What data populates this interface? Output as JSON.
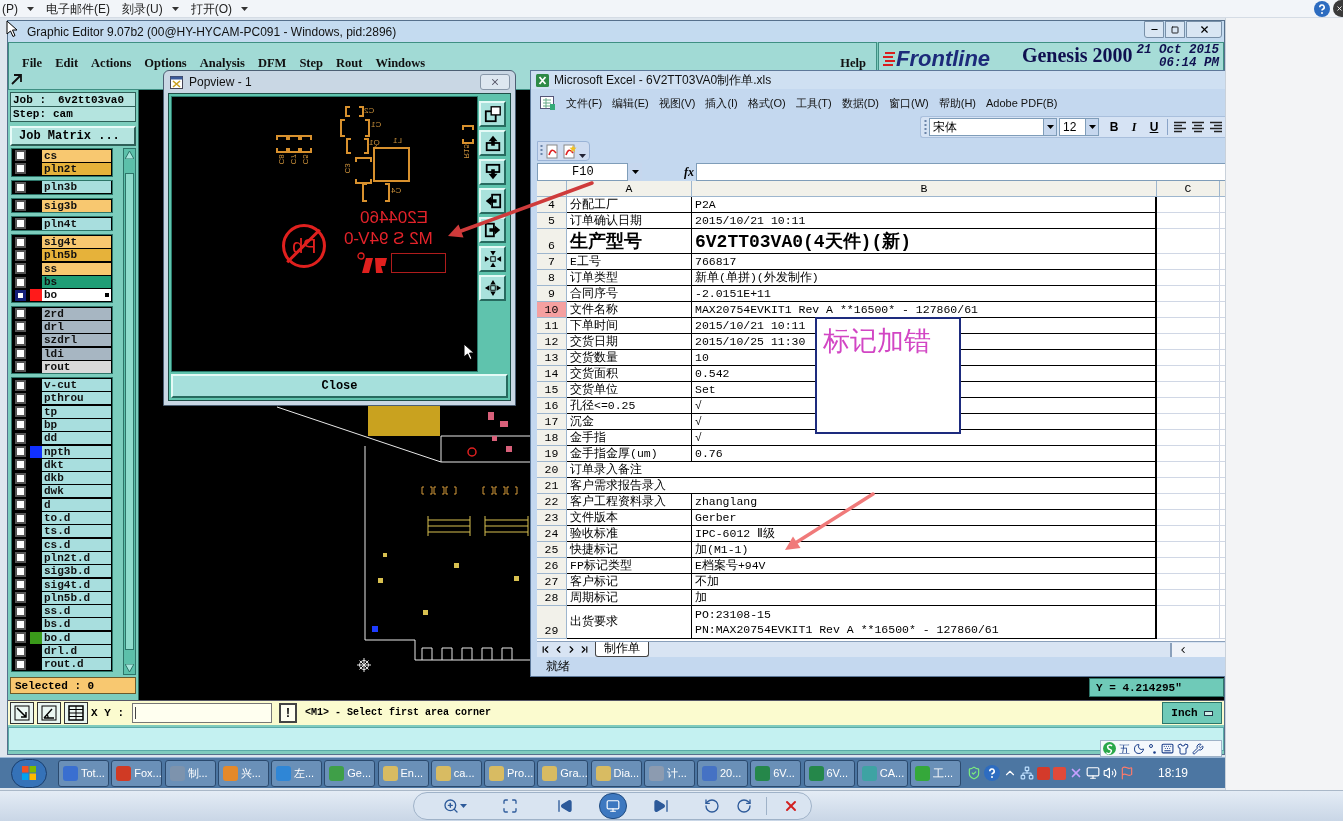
{
  "viewer_menu": [
    {
      "label": "(P)",
      "dropdown": true
    },
    {
      "label": "电子邮件(E)",
      "dropdown": false
    },
    {
      "label": "刻录(U)",
      "dropdown": true
    },
    {
      "label": "打开(O)",
      "dropdown": true
    }
  ],
  "genesis": {
    "title": "Graphic Editor 9.07b2 (00@HY-HYCAM-PC091 - Windows, pid:2896)",
    "menu": [
      "File",
      "Edit",
      "Actions",
      "Options",
      "Analysis",
      "DFM",
      "Step",
      "Rout",
      "Windows"
    ],
    "help_menu": "Help",
    "brand": {
      "logo": "Frontline",
      "product": "Genesis 2000",
      "date": "21 Oct 2015",
      "time": "06:14 PM"
    },
    "job": {
      "label": "Job :",
      "value": "6v2tt03va0"
    },
    "step": {
      "label": "Step:",
      "value": "cam"
    },
    "job_matrix_button": "Job Matrix ...",
    "layer_groups": [
      {
        "layers": [
          {
            "name": "cs",
            "color": "#f8c870",
            "selected": false
          },
          {
            "name": "pln2t",
            "color": "#e6b23a",
            "selected": false
          }
        ]
      },
      {
        "layers": [
          {
            "name": "pln3b",
            "color": "#a8dede",
            "selected": false
          }
        ]
      },
      {
        "layers": [
          {
            "name": "sig3b",
            "color": "#f8c870",
            "selected": false
          }
        ]
      },
      {
        "layers": [
          {
            "name": "pln4t",
            "color": "#a8dede",
            "selected": false
          }
        ]
      },
      {
        "layers": [
          {
            "name": "sig4t",
            "color": "#f8c870",
            "selected": false
          },
          {
            "name": "pln5b",
            "color": "#e6b23a",
            "selected": false
          },
          {
            "name": "ss",
            "color": "#f8c870",
            "selected": false
          },
          {
            "name": "bs",
            "color": "#1f9e76",
            "selected": false
          },
          {
            "name": "bo",
            "color": "#ffffff",
            "selected": true,
            "swatch": {
              "color": "#ff1a1a"
            }
          }
        ]
      },
      {
        "layers": [
          {
            "name": "2rd",
            "color": "#a7b6c2",
            "selected": false
          },
          {
            "name": "drl",
            "color": "#a7b6c2",
            "selected": false
          },
          {
            "name": "szdrl",
            "color": "#a7b6c2",
            "selected": false
          },
          {
            "name": "ldi",
            "color": "#a7b6c2",
            "selected": false
          },
          {
            "name": "rout",
            "color": "#dadada",
            "selected": false
          }
        ]
      },
      {
        "layers": [
          {
            "name": "v-cut",
            "color": "#a8dede",
            "selected": false
          },
          {
            "name": "pthrou",
            "color": "#a8dede",
            "selected": false
          },
          {
            "name": "tp",
            "color": "#a8dede",
            "selected": false
          },
          {
            "name": "bp",
            "color": "#a8dede",
            "selected": false
          },
          {
            "name": "dd",
            "color": "#a8dede",
            "selected": false
          },
          {
            "name": "npth",
            "color": "#a8dede",
            "selected": false,
            "swatch": {
              "color": "#1030ff"
            }
          },
          {
            "name": "dkt",
            "color": "#a8dede",
            "selected": false
          },
          {
            "name": "dkb",
            "color": "#a8dede",
            "selected": false
          },
          {
            "name": "dwk",
            "color": "#a8dede",
            "selected": false
          },
          {
            "name": "d",
            "color": "#a8dede",
            "selected": false
          },
          {
            "name": "to.d",
            "color": "#a8dede",
            "selected": false
          },
          {
            "name": "ts.d",
            "color": "#a8dede",
            "selected": false
          },
          {
            "name": "cs.d",
            "color": "#a8dede",
            "selected": false
          },
          {
            "name": "pln2t.d",
            "color": "#a8dede",
            "selected": false
          },
          {
            "name": "sig3b.d",
            "color": "#a8dede",
            "selected": false
          },
          {
            "name": "sig4t.d",
            "color": "#a8dede",
            "selected": false
          },
          {
            "name": "pln5b.d",
            "color": "#a8dede",
            "selected": false
          },
          {
            "name": "ss.d",
            "color": "#a8dede",
            "selected": false
          },
          {
            "name": "bs.d",
            "color": "#a8dede",
            "selected": false
          },
          {
            "name": "bo.d",
            "color": "#a8dede",
            "selected": false,
            "swatch": {
              "color": "#3a9a1a"
            }
          },
          {
            "name": "drl.d",
            "color": "#a8dede",
            "selected": false
          },
          {
            "name": "rout.d",
            "color": "#a8dede",
            "selected": false
          }
        ]
      }
    ],
    "selected_count": "Selected : 0",
    "coordinate": "Y = 4.214295\"",
    "xy_label": "X Y :",
    "alert_button": "!",
    "prompt": "<M1> - Select first area corner",
    "units_button": "Inch"
  },
  "popview": {
    "title": "Popview - 1",
    "silkscreen": [
      "C2",
      "C1",
      "Q1",
      "L1",
      "C3",
      "C4",
      "C8",
      "C7",
      "C5",
      "R15"
    ],
    "marking_lines": [
      "E204460",
      "M2 S 94V-0"
    ],
    "pb_mark": "Pb",
    "close_button": "Close"
  },
  "excel": {
    "title": "Microsoft Excel - 6V2TT03VA0制作单.xls",
    "menu": [
      "文件(F)",
      "编辑(E)",
      "视图(V)",
      "插入(I)",
      "格式(O)",
      "工具(T)",
      "数据(D)",
      "窗口(W)",
      "帮助(H)",
      "Adobe PDF(B)"
    ],
    "font": "宋体",
    "font_size": "12",
    "format_buttons": [
      "B",
      "I",
      "U"
    ],
    "name_box": "F10",
    "function_button": "fx",
    "columns": [
      "A",
      "B",
      "C"
    ],
    "rows": [
      {
        "num": "4",
        "label": "分配工厂",
        "value": "P2A",
        "kind": "normal",
        "selected": false
      },
      {
        "num": "5",
        "label": "订单确认日期",
        "value": "2015/10/21 10:11",
        "kind": "normal",
        "selected": false
      },
      {
        "num": "6",
        "label": "生产型号",
        "value": "6V2TT03VA0(4天件)(新)",
        "kind": "large",
        "selected": false
      },
      {
        "num": "7",
        "label": "E工号",
        "value": "766817",
        "kind": "normal",
        "selected": false
      },
      {
        "num": "8",
        "label": "订单类型",
        "value": "新单(单拼)(外发制作)",
        "kind": "normal",
        "selected": false
      },
      {
        "num": "9",
        "label": "合同序号",
        "value": "-2.0151E+11",
        "kind": "normal",
        "selected": false
      },
      {
        "num": "10",
        "label": "文件名称",
        "value": "MAX20754EVKIT1 Rev A **16500* - 127860/61",
        "kind": "normal",
        "selected": true
      },
      {
        "num": "11",
        "label": "下单时间",
        "value": "2015/10/21 10:11",
        "kind": "normal",
        "selected": false
      },
      {
        "num": "12",
        "label": "交货日期",
        "value": "2015/10/25 11:30",
        "kind": "normal",
        "selected": false
      },
      {
        "num": "13",
        "label": "交货数量",
        "value": "10",
        "kind": "normal",
        "selected": false
      },
      {
        "num": "14",
        "label": "交货面积",
        "value": "0.542",
        "kind": "normal",
        "selected": false
      },
      {
        "num": "15",
        "label": "交货单位",
        "value": "Set",
        "kind": "normal",
        "selected": false
      },
      {
        "num": "16",
        "label": "孔径<=0.25",
        "value": "√",
        "kind": "normal",
        "selected": false
      },
      {
        "num": "17",
        "label": "沉金",
        "value": "√",
        "kind": "normal",
        "selected": false
      },
      {
        "num": "18",
        "label": "金手指",
        "value": "√",
        "kind": "normal",
        "selected": false
      },
      {
        "num": "19",
        "label": "金手指金厚(um)",
        "value": "0.76",
        "kind": "normal",
        "selected": false
      },
      {
        "num": "20",
        "label": "订单录入备注",
        "kind": "merged",
        "selected": false
      },
      {
        "num": "21",
        "label": "客户需求报告录入",
        "kind": "merged",
        "selected": false
      },
      {
        "num": "22",
        "label": "客户工程资料录入",
        "value": "zhanglang",
        "kind": "normal",
        "selected": false
      },
      {
        "num": "23",
        "label": "文件版本",
        "value": "Gerber",
        "kind": "normal",
        "selected": false
      },
      {
        "num": "24",
        "label": "验收标准",
        "value": "IPC-6012 Ⅱ级",
        "kind": "normal",
        "selected": false
      },
      {
        "num": "25",
        "label": "快捷标记",
        "value": "加(M1-1)",
        "kind": "normal",
        "selected": false
      },
      {
        "num": "26",
        "label": "FP标记类型",
        "value": "E档案号+94V",
        "kind": "normal",
        "selected": false
      },
      {
        "num": "27",
        "label": "客户标记",
        "value": "不加",
        "kind": "normal",
        "selected": false
      },
      {
        "num": "28",
        "label": "周期标记",
        "value": "加",
        "kind": "normal",
        "selected": false
      },
      {
        "num": "29",
        "label": "出货要求",
        "value_lines": [
          "PO:23108-15",
          "PN:MAX20754EVKIT1 Rev A **16500* - 127860/61"
        ],
        "kind": "multiline",
        "selected": false
      }
    ],
    "sheet_tabs": [
      {
        "label": "制作单",
        "selected": true
      }
    ],
    "status": "就绪"
  },
  "callout": "标记加错",
  "ime_bar": {
    "mode": "五"
  },
  "taskbar": {
    "items": [
      {
        "label": "Tot...",
        "color": "#3a6fd0"
      },
      {
        "label": "Fox...",
        "color": "#d03a24"
      },
      {
        "label": "制...",
        "color": "#7d93ad"
      },
      {
        "label": "兴...",
        "color": "#e5892a"
      },
      {
        "label": "左...",
        "color": "#2f86d6"
      },
      {
        "label": "Ge...",
        "color": "#3f9f48"
      },
      {
        "label": "En...",
        "color": "#d8bb62"
      },
      {
        "label": "ca...",
        "color": "#d8bb62"
      },
      {
        "label": "Pro...",
        "color": "#d8bb62"
      },
      {
        "label": "Gra...",
        "color": "#d8bb62"
      },
      {
        "label": "Dia...",
        "color": "#d8bb62"
      },
      {
        "label": "计...",
        "color": "#8c9bb0"
      },
      {
        "label": "20...",
        "color": "#4572c4"
      },
      {
        "label": "6V...",
        "color": "#25874a"
      },
      {
        "label": "6V...",
        "color": "#25874a"
      },
      {
        "label": "CA...",
        "color": "#3ea3a3"
      },
      {
        "label": "工...",
        "color": "#35a83a"
      }
    ],
    "clock": "18:19"
  }
}
